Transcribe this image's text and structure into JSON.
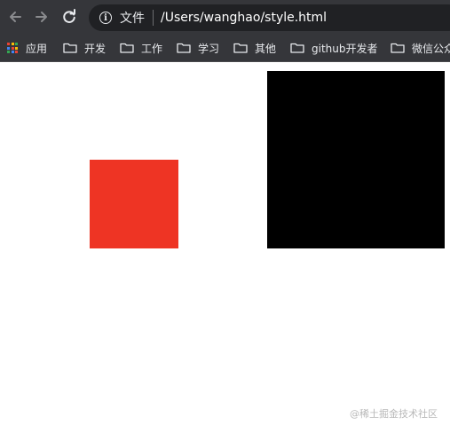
{
  "browser": {
    "file_label": "文件",
    "url": "/Users/wanghao/style.html"
  },
  "bookmarks": {
    "apps_label": "应用",
    "items": [
      "开发",
      "工作",
      "学习",
      "其他",
      "github开发者",
      "微信公众号"
    ]
  },
  "page": {
    "red_box_color": "#ee3424",
    "black_box_color": "#000000"
  },
  "watermark": "@稀土掘金技术社区"
}
